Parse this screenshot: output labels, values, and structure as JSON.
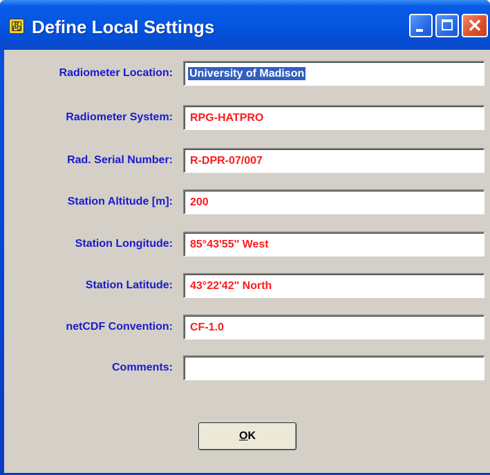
{
  "window": {
    "title": "Define Local Settings",
    "icon": "rpg-app-icon",
    "controls": {
      "minimize": "minimize-icon",
      "maximize": "maximize-icon",
      "close": "close-icon"
    }
  },
  "fields": [
    {
      "label": "Radiometer Location:",
      "value": "University of Madison",
      "selected": true
    },
    {
      "label": "Radiometer System:",
      "value": "RPG-HATPRO"
    },
    {
      "label": "Rad. Serial Number:",
      "value": "R-DPR-07/007"
    },
    {
      "label": "Station Altitude [m]:",
      "value": "200"
    },
    {
      "label": "Station Longitude:",
      "value": "85°43'55'' West"
    },
    {
      "label": "Station Latitude:",
      "value": "43°22'42'' North"
    },
    {
      "label": "netCDF Convention:",
      "value": "CF-1.0"
    },
    {
      "label": "Comments:",
      "value": ""
    }
  ],
  "ok_button": {
    "mnemonic": "O",
    "rest": "K"
  },
  "colors": {
    "label": "#1a1acc",
    "value": "#ff1a1a",
    "dialog_bg": "#d4d0c8",
    "titlebar": "#0556e0"
  }
}
